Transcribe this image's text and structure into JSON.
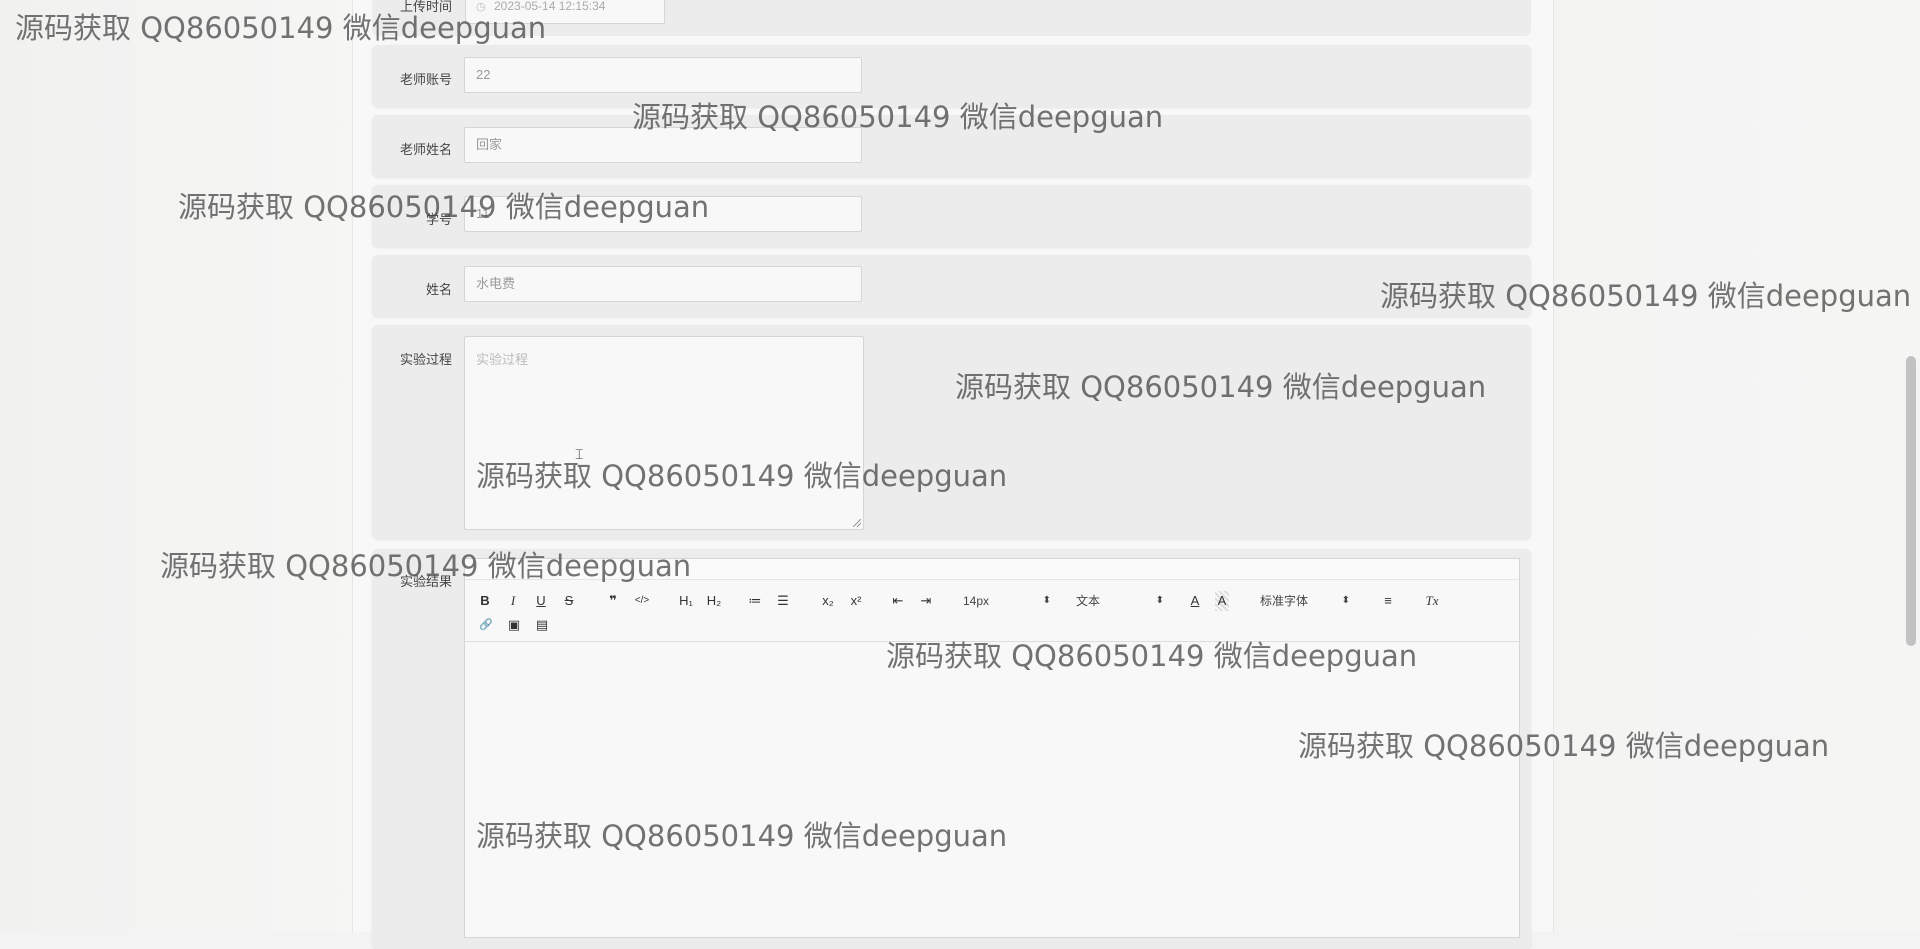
{
  "form": {
    "upload_time": {
      "label": "上传时间",
      "value": "2023-05-14 12:15:34",
      "icon": "clock-icon"
    },
    "teacher_account": {
      "label": "老师账号",
      "value": "22"
    },
    "teacher_name": {
      "label": "老师姓名",
      "value": "回家"
    },
    "student_id": {
      "label": "学号",
      "value": "11"
    },
    "name": {
      "label": "姓名",
      "value": "水电费"
    },
    "experiment_process": {
      "label": "实验过程",
      "placeholder": "实验过程",
      "value": ""
    },
    "experiment_result": {
      "label": "实验结果"
    }
  },
  "editor": {
    "toolbar": {
      "bold": "B",
      "italic": "I",
      "underline": "U",
      "strike": "S",
      "blockquote": "❞",
      "code": "</>",
      "h1": "H₁",
      "h2": "H₂",
      "ordered_list": "≔",
      "bullet_list": "☰",
      "subscript": "x₂",
      "superscript": "x²",
      "outdent": "⇤",
      "indent": "⇥",
      "font_size": "14px",
      "header": "文本",
      "font_color": "A",
      "bg_color": "A",
      "font_family": "标准字体",
      "align": "≡",
      "clean": "Tx",
      "link": "🔗",
      "image": "▣",
      "video": "▤"
    }
  },
  "watermark_text": "源码获取 QQ86050149 微信deepguan"
}
